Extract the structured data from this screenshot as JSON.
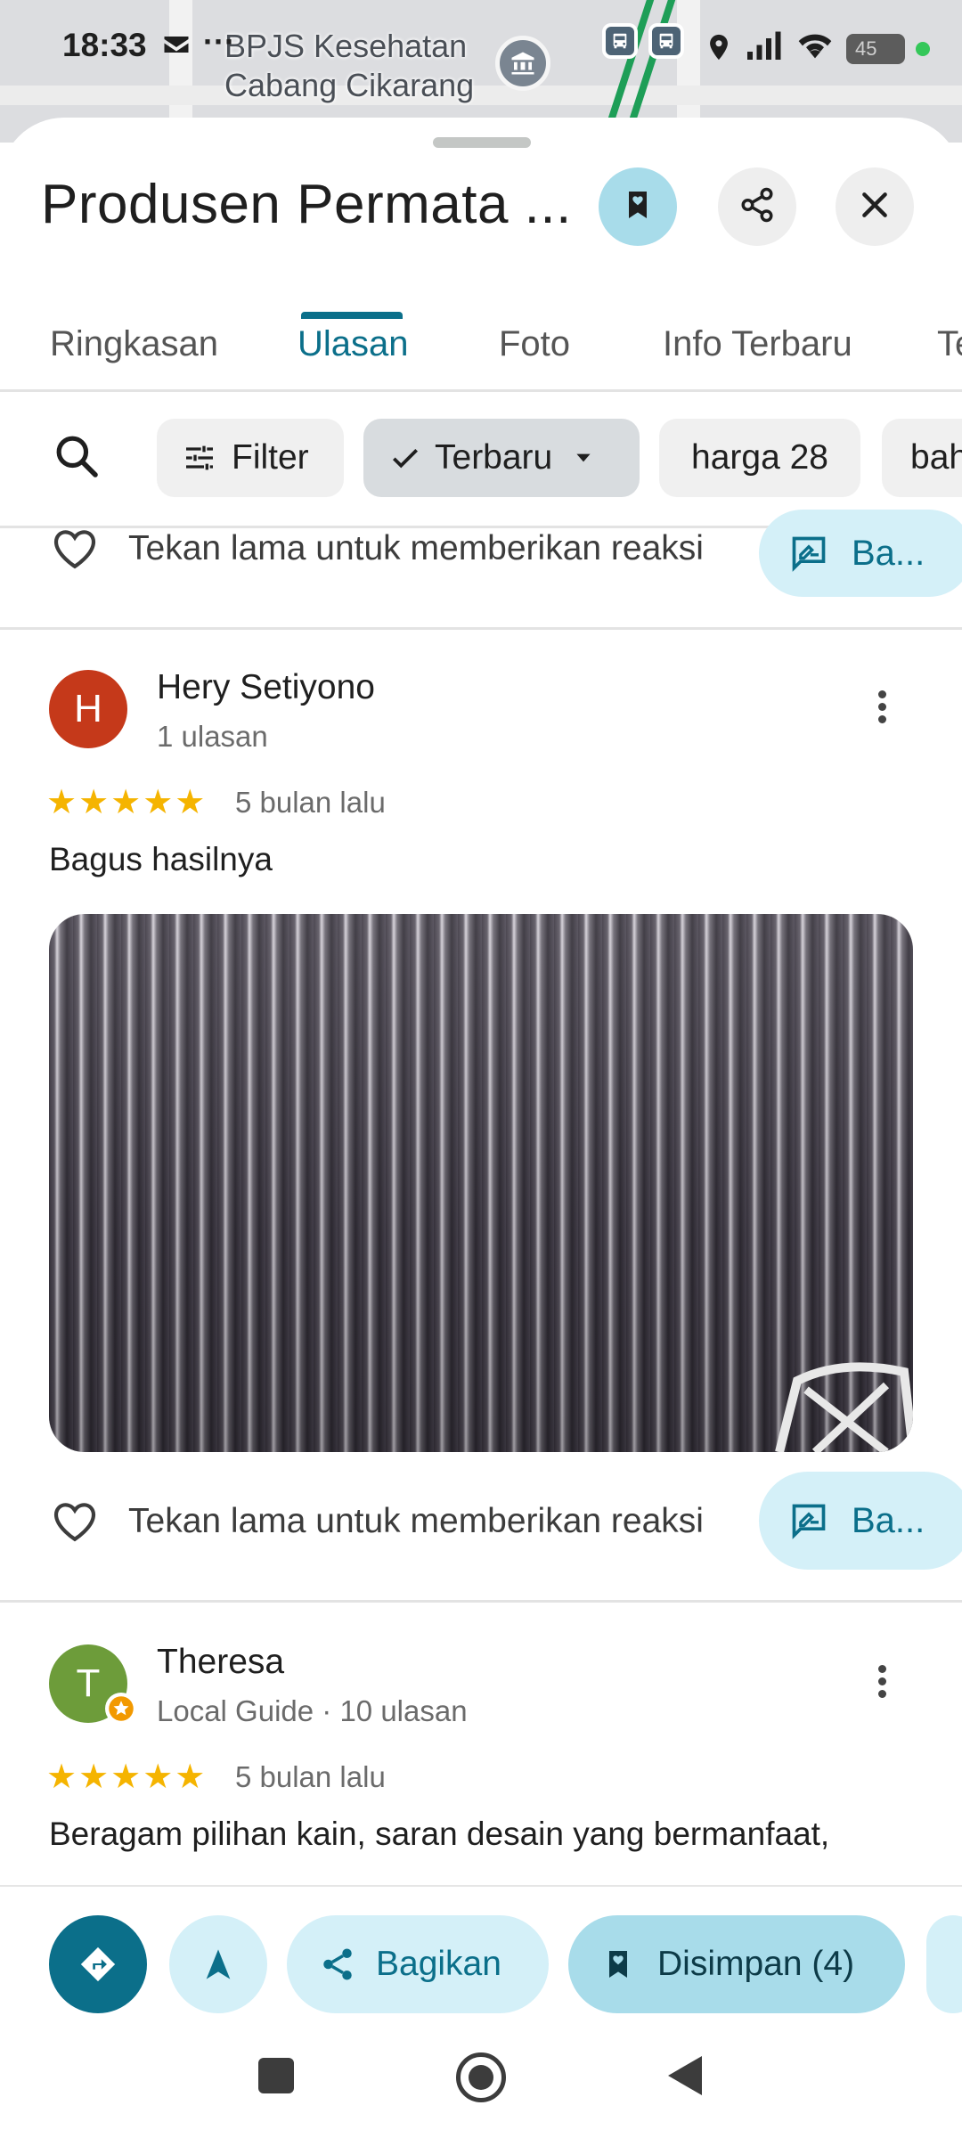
{
  "status_bar": {
    "time": "18:33",
    "more": "···",
    "battery": "45"
  },
  "map": {
    "label_line1": "BPJS Kesehatan",
    "label_line2": "Cabang Cikarang",
    "poi_icon": "government-building-icon"
  },
  "place": {
    "title": "Produsen Permata ..."
  },
  "tabs": [
    {
      "label": "Ringkasan",
      "active": false
    },
    {
      "label": "Ulasan",
      "active": true
    },
    {
      "label": "Foto",
      "active": false
    },
    {
      "label": "Info Terbaru",
      "active": false
    },
    {
      "label": "Te",
      "active": false
    }
  ],
  "filters": {
    "filter_label": "Filter",
    "sort_label": "Terbaru",
    "chip_harga": "harga 28",
    "chip_bahan": "bah"
  },
  "reaction": {
    "prompt": "Tekan lama untuk memberikan reaksi",
    "share_label": "Ba..."
  },
  "reviews": [
    {
      "initial": "H",
      "avatar_color": "#c5391a",
      "name": "Hery Setiyono",
      "subtitle": "1 ulasan",
      "stars": "★★★★★",
      "rating": 5,
      "time": "5 bulan lalu",
      "text": "Bagus hasilnya"
    },
    {
      "initial": "T",
      "avatar_color": "#6d9c3a",
      "name": "Theresa",
      "subtitle": "Local Guide · 10 ulasan",
      "stars": "★★★★★",
      "rating": 5,
      "time": "5 bulan lalu",
      "text": "Beragam pilihan kain, saran desain yang bermanfaat,"
    }
  ],
  "action_bar": {
    "share_label": "Bagikan",
    "saved_label": "Disimpan (4)"
  },
  "colors": {
    "accent": "#0b6f8a",
    "accent_light": "#d4f0f8",
    "star": "#f5b400"
  }
}
